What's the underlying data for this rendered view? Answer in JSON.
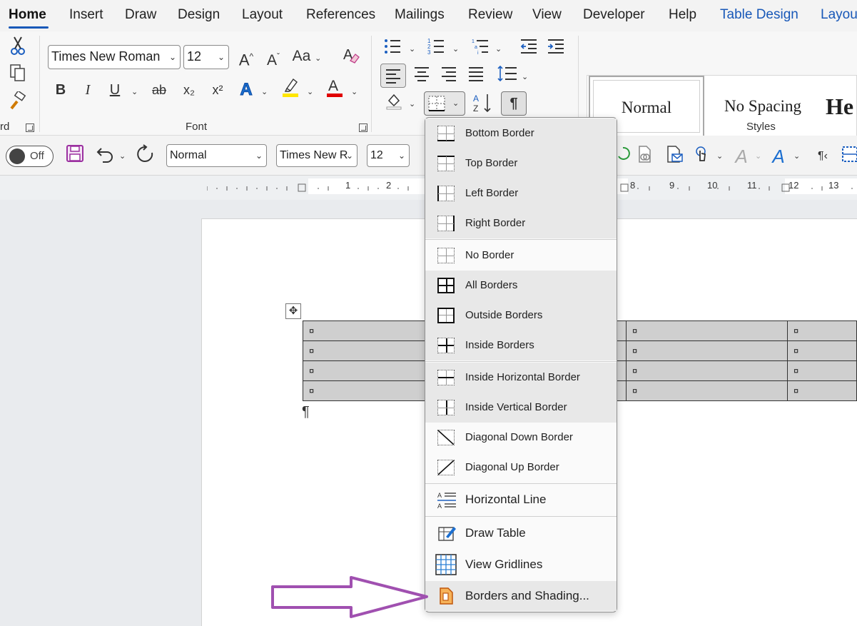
{
  "tabs": [
    "Home",
    "Insert",
    "Draw",
    "Design",
    "Layout",
    "References",
    "Mailings",
    "Review",
    "View",
    "Developer",
    "Help",
    "Table Design",
    "Layou"
  ],
  "ribbon": {
    "font_name": "Times New Roman",
    "font_size": "12",
    "font_group_label": "Font",
    "clipboard_group_label": "rd",
    "styles_group_label": "Styles",
    "styles": [
      "Normal",
      "No Spacing",
      "He"
    ],
    "bold": "B",
    "italic": "I",
    "underline": "U",
    "strike": "ab",
    "subscript": "x₂",
    "superscript": "x²",
    "grow": "A^",
    "shrink": "Aˇ",
    "change_case": "Aa",
    "text_effects": "A",
    "font_color": "A"
  },
  "qat": {
    "autosave_state": "Off",
    "style_value": "Normal",
    "font_value": "Times New R",
    "size_value": "12"
  },
  "ruler": {
    "left_numbers": [
      "1",
      "2"
    ],
    "right_numbers": [
      "8",
      "9",
      "10",
      "11",
      "12",
      "13"
    ]
  },
  "document": {
    "cell_marker": "¤",
    "paragraph_mark": "¶"
  },
  "menu": {
    "items": [
      {
        "label": "Bottom Border"
      },
      {
        "label": "Top Border"
      },
      {
        "label": "Left Border"
      },
      {
        "label": "Right Border"
      },
      {
        "label": "No Border"
      },
      {
        "label": "All Borders"
      },
      {
        "label": "Outside Borders"
      },
      {
        "label": "Inside Borders"
      },
      {
        "label": "Inside Horizontal Border"
      },
      {
        "label": "Inside Vertical Border"
      },
      {
        "label": "Diagonal Down Border"
      },
      {
        "label": "Diagonal Up Border"
      },
      {
        "label": "Horizontal Line"
      },
      {
        "label": "Draw Table"
      },
      {
        "label": "View Gridlines"
      },
      {
        "label": "Borders and Shading..."
      }
    ]
  },
  "colors": {
    "accent_blue": "#1858b8",
    "highlight_yellow": "#ffe600",
    "font_red": "#e00000",
    "arrow_purple": "#a050b0",
    "save_purple": "#9b30a0"
  }
}
